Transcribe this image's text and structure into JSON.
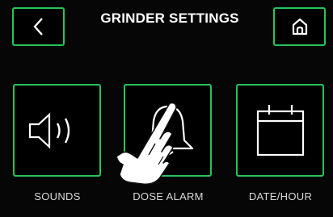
{
  "header": {
    "title": "GRINDER SETTINGS",
    "back_icon": "chevron-left-icon",
    "home_icon": "home-icon"
  },
  "options": [
    {
      "label": "SOUNDS",
      "icon": "speaker-icon"
    },
    {
      "label": "DOSE ALARM",
      "icon": "bell-icon"
    },
    {
      "label": "DATE/HOUR",
      "icon": "calendar-icon"
    }
  ],
  "overlay": {
    "icon": "pointing-hand-icon"
  },
  "colors": {
    "accent": "#27c45a",
    "background": "#060606",
    "text": "#ffffff"
  }
}
